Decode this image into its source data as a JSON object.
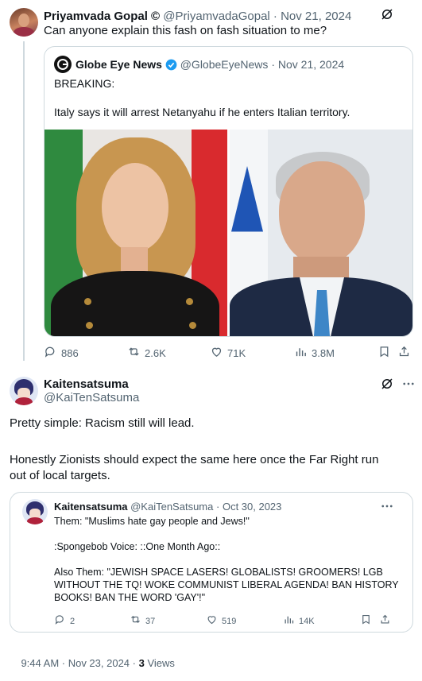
{
  "post1": {
    "display_name": "Priyamvada Gopal ©",
    "handle": "@PriyamvadaGopal",
    "date": "Nov 21, 2024",
    "text": "Can anyone explain this fash on fash situation to me?",
    "quote": {
      "display_name": "Globe Eye News",
      "handle": "@GlobeEyeNews",
      "date": "Nov 21, 2024",
      "line1": "BREAKING:",
      "line2": "Italy says it will arrest Netanyahu if he enters Italian territory."
    },
    "stats": {
      "replies": "886",
      "reposts": "2.6K",
      "likes": "71K",
      "views": "3.8M"
    }
  },
  "post2": {
    "display_name": "Kaitensatsuma",
    "handle": "@KaiTenSatsuma",
    "text_line1": "Pretty simple: Racism still will lead.",
    "text_line2": "Honestly Zionists should expect the same here once the Far Right run",
    "text_line3": "out of local targets.",
    "quote": {
      "display_name": "Kaitensatsuma",
      "handle": "@KaiTenSatsuma",
      "date": "Oct 30, 2023",
      "line1": "Them: \"Muslims hate gay people and Jews!\"",
      "line2": ":Spongebob Voice: ::One Month Ago::",
      "line3": "Also Them: \"JEWISH SPACE LASERS! GLOBALISTS! GROOMERS! LGB",
      "line4": "WITHOUT THE TQ! WOKE COMMUNIST LIBERAL AGENDA! BAN HISTORY",
      "line5": "BOOKS! BAN THE WORD 'GAY'!\"",
      "stats": {
        "replies": "2",
        "reposts": "37",
        "likes": "519",
        "views": "14K"
      }
    },
    "footer": {
      "time": "9:44 AM · Nov 23, 2024 · ",
      "views_count": "3",
      "views_label": " Views"
    }
  },
  "colors": {
    "accent": "#1d9bf0",
    "muted": "#536471",
    "border": "#cfd9de",
    "text": "#0f1419"
  },
  "icons": [
    "grok-icon",
    "more-icon",
    "reply-icon",
    "repost-icon",
    "like-icon",
    "views-icon",
    "bookmark-icon",
    "share-icon",
    "verified-icon"
  ]
}
